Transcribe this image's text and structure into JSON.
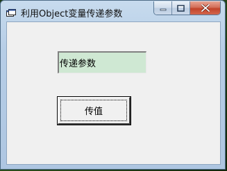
{
  "window": {
    "title": "利用Object变量传递参数",
    "icon": "app-window-icon",
    "caption_buttons": [
      "minimize-icon",
      "maximize-icon",
      "close-icon"
    ]
  },
  "form": {
    "textbox_value": "传递参数",
    "button_label": "传值"
  },
  "colors": {
    "textbox_background": "#cfe8d3",
    "client_background": "#f0f0f0",
    "close_button": "#c2432a"
  }
}
